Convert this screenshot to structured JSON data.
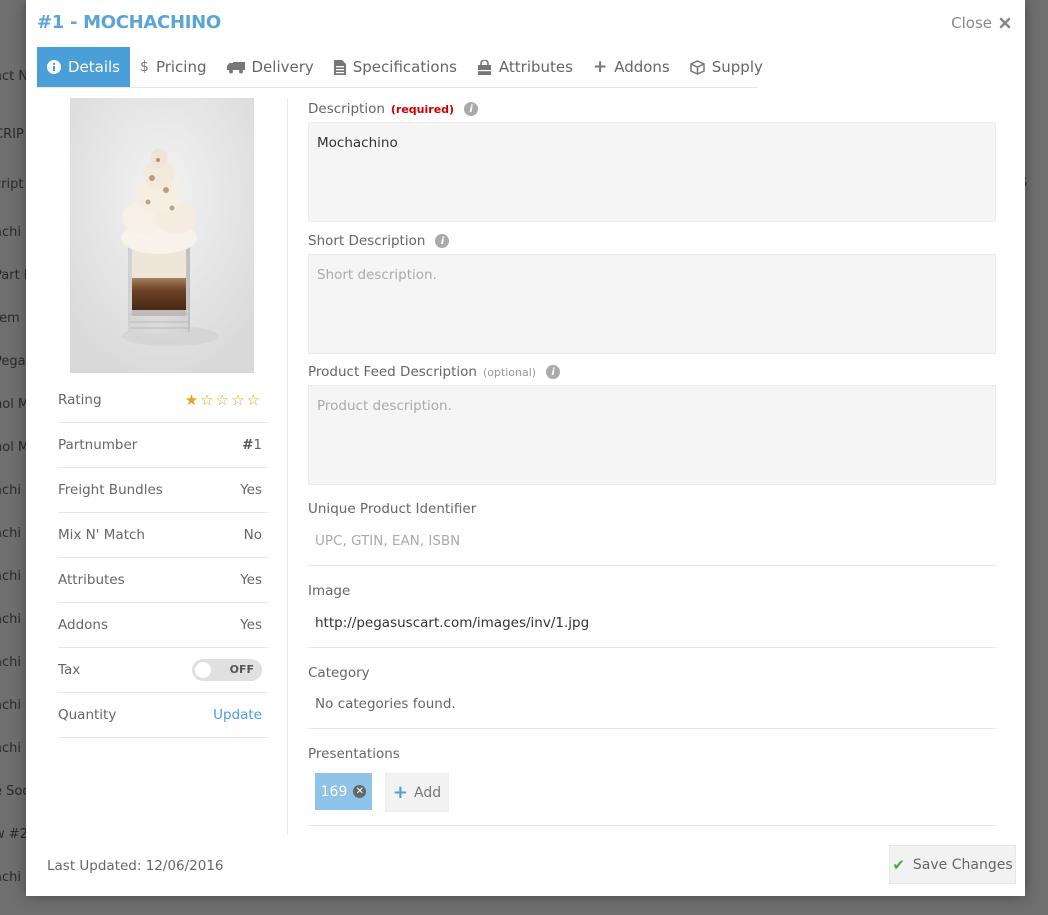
{
  "background": {
    "rows": [
      "act N",
      "CRIP",
      "cript",
      "achi",
      "Part N",
      "tem",
      "Pega",
      "hol M",
      "hol M",
      "achi",
      "achi",
      "achi",
      "achi",
      "achi",
      "achi",
      "achi",
      "e Soo",
      "w #2",
      "achi"
    ],
    "right_fragment": "S"
  },
  "modal": {
    "title": "#1 - MOCHACHINO",
    "close_label": "Close"
  },
  "tabs": [
    {
      "label": "Details",
      "icon": "info-icon",
      "active": true
    },
    {
      "label": "Pricing",
      "icon": "dollar-icon"
    },
    {
      "label": "Delivery",
      "icon": "truck-icon"
    },
    {
      "label": "Specifications",
      "icon": "document-icon"
    },
    {
      "label": "Attributes",
      "icon": "shopping-bag-icon"
    },
    {
      "label": "Addons",
      "icon": "plus-icon"
    },
    {
      "label": "Supply",
      "icon": "cube-icon"
    }
  ],
  "summary": {
    "rating_label": "Rating",
    "rating_value": 1,
    "rating_max": 5,
    "partnumber_label": "Partnumber",
    "partnumber_value": "1",
    "freight_label": "Freight Bundles",
    "freight_value": "Yes",
    "mix_label": "Mix N' Match",
    "mix_value": "No",
    "attributes_label": "Attributes",
    "attributes_value": "Yes",
    "addons_label": "Addons",
    "addons_value": "Yes",
    "tax_label": "Tax",
    "tax_toggle": "OFF",
    "quantity_label": "Quantity",
    "quantity_link": "Update"
  },
  "form": {
    "description_label": "Description",
    "description_required": "(required)",
    "description_value": "Mochachino",
    "short_label": "Short Description",
    "short_placeholder": "Short description.",
    "feed_label": "Product Feed Description",
    "feed_optional": "(optional)",
    "feed_placeholder": "Product description.",
    "upi_label": "Unique Product Identifier",
    "upi_placeholder": "UPC, GTIN, EAN, ISBN",
    "image_label": "Image",
    "image_value": "http://pegasuscart.com/images/inv/1.jpg",
    "category_label": "Category",
    "category_value": "No categories found.",
    "presentations_label": "Presentations",
    "presentation_chip": "169",
    "add_label": "Add"
  },
  "footer": {
    "last_updated": "Last Updated: 12/06/2016",
    "save_label": "Save Changes"
  },
  "colors": {
    "accent": "#4a9fd8",
    "title": "#5aa4d6",
    "required": "#cc0000",
    "star": "#e8a317",
    "save_check": "#3fae4f"
  }
}
